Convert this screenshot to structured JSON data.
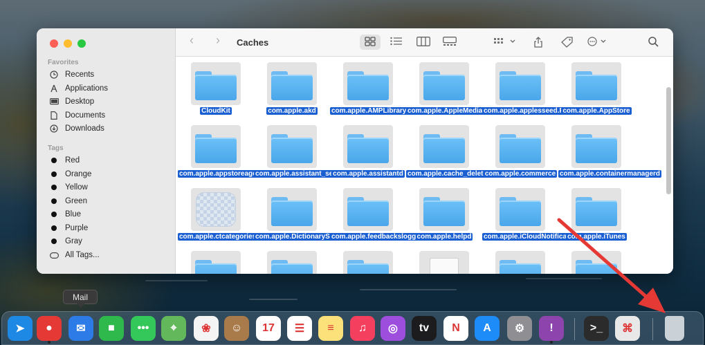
{
  "window": {
    "title": "Caches",
    "sidebar": {
      "favorites_header": "Favorites",
      "favorites": [
        {
          "label": "Recents",
          "icon": "clock-icon"
        },
        {
          "label": "Applications",
          "icon": "applications-icon"
        },
        {
          "label": "Desktop",
          "icon": "desktop-icon"
        },
        {
          "label": "Documents",
          "icon": "document-icon"
        },
        {
          "label": "Downloads",
          "icon": "download-icon"
        }
      ],
      "tags_header": "Tags",
      "tags": [
        {
          "label": "Red"
        },
        {
          "label": "Orange"
        },
        {
          "label": "Yellow"
        },
        {
          "label": "Green"
        },
        {
          "label": "Blue"
        },
        {
          "label": "Purple"
        },
        {
          "label": "Gray"
        }
      ],
      "all_tags": "All Tags..."
    },
    "files": [
      {
        "name": "CloudKit",
        "icon": "folder"
      },
      {
        "name": "com.apple.akd",
        "icon": "folder"
      },
      {
        "name": "com.apple.AMPLibraryAgent",
        "icon": "folder"
      },
      {
        "name": "com.apple.AppleMediaServices",
        "icon": "folder"
      },
      {
        "name": "com.apple.applesseed.Fee...ssistant",
        "icon": "folder"
      },
      {
        "name": "com.apple.AppStore",
        "icon": "folder"
      },
      {
        "name": "com.apple.appstoreagent",
        "icon": "folder"
      },
      {
        "name": "com.apple.assistant_service",
        "icon": "folder"
      },
      {
        "name": "com.apple.assistantd",
        "icon": "folder"
      },
      {
        "name": "com.apple.cache_delete",
        "icon": "folder"
      },
      {
        "name": "com.apple.commerce",
        "icon": "folder"
      },
      {
        "name": "com.apple.containermanagerd",
        "icon": "folder"
      },
      {
        "name": "com.apple.ctcategories.service",
        "icon": "service"
      },
      {
        "name": "com.apple.DictionaryServices",
        "icon": "folder"
      },
      {
        "name": "com.apple.feedbackslogger",
        "icon": "folder"
      },
      {
        "name": "com.apple.helpd",
        "icon": "folder"
      },
      {
        "name": "com.apple.iCloudNotificationAgent",
        "icon": "folder"
      },
      {
        "name": "com.apple.iTunes",
        "icon": "folder"
      },
      {
        "name": "",
        "icon": "folder"
      },
      {
        "name": "",
        "icon": "folder"
      },
      {
        "name": "",
        "icon": "folder"
      },
      {
        "name": "",
        "icon": "document"
      },
      {
        "name": "",
        "icon": "folder"
      },
      {
        "name": "",
        "icon": "folder"
      }
    ]
  },
  "tooltip": "Mail",
  "dock": [
    {
      "name": "safari",
      "color": "#1e88e5",
      "glyph": "➤",
      "running": false
    },
    {
      "name": "chrome",
      "color": "#e53935",
      "glyph": "●",
      "running": true
    },
    {
      "name": "mail",
      "color": "#2d7be6",
      "glyph": "✉",
      "running": false
    },
    {
      "name": "facetime",
      "color": "#2fb84c",
      "glyph": "■",
      "running": false
    },
    {
      "name": "messages",
      "color": "#34c759",
      "glyph": "•••",
      "running": false
    },
    {
      "name": "maps",
      "color": "#62b85a",
      "glyph": "⌖",
      "running": false
    },
    {
      "name": "photos",
      "color": "#f4f4f4",
      "glyph": "❀",
      "running": false
    },
    {
      "name": "contacts",
      "color": "#a97a4a",
      "glyph": "☺",
      "running": false
    },
    {
      "name": "calendar",
      "color": "#ffffff",
      "glyph": "17",
      "running": false
    },
    {
      "name": "reminders",
      "color": "#ffffff",
      "glyph": "☰",
      "running": false
    },
    {
      "name": "notes",
      "color": "#fce07a",
      "glyph": "≡",
      "running": false
    },
    {
      "name": "music",
      "color": "#f43f5e",
      "glyph": "♫",
      "running": false
    },
    {
      "name": "podcasts",
      "color": "#9d4edd",
      "glyph": "◎",
      "running": false
    },
    {
      "name": "apple-tv",
      "color": "#1c1c1e",
      "glyph": "tv",
      "running": false
    },
    {
      "name": "news",
      "color": "#ffffff",
      "glyph": "N",
      "running": false
    },
    {
      "name": "app-store",
      "color": "#1d8cf8",
      "glyph": "A",
      "running": false
    },
    {
      "name": "system-preferences",
      "color": "#8e8e93",
      "glyph": "⚙",
      "running": false
    },
    {
      "name": "feedback",
      "color": "#8e44ad",
      "glyph": "!",
      "running": true
    },
    {
      "name": "terminal",
      "color": "#2b2b2b",
      "glyph": ">_",
      "running": false
    },
    {
      "name": "preview",
      "color": "#e8e8e8",
      "glyph": "⌘",
      "running": false
    },
    {
      "name": "trash",
      "color": "#d0d4d8",
      "glyph": "",
      "running": false
    }
  ],
  "colors": {
    "selection": "#1a5fd1",
    "folder": "#4aa7ea",
    "arrow": "#e53935"
  }
}
